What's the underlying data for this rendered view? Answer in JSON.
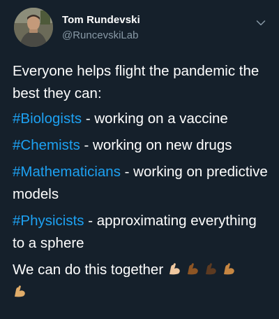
{
  "tweet": {
    "author_name": "Tom Rundevski",
    "author_handle": "@RuncevskiLab",
    "intro": "Everyone helps flight the pandemic the best they can:",
    "lines": [
      {
        "hashtag": "#Biologists",
        "text": " - working on a vaccine"
      },
      {
        "hashtag": "#Chemists",
        "text": " - working on new drugs"
      },
      {
        "hashtag": "#Mathematicians",
        "text": " - working on predictive models"
      },
      {
        "hashtag": "#Physicists",
        "text": " - approximating everything to a sphere"
      }
    ],
    "closing": "We can do this together",
    "emojis": [
      "flexed-biceps-light",
      "flexed-biceps-medium-dark",
      "flexed-biceps-dark",
      "flexed-biceps-medium",
      "flexed-biceps-medium-light"
    ]
  },
  "colors": {
    "background": "#15202b",
    "text": "#ffffff",
    "handle": "#8899a6",
    "hashtag": "#1da1f2",
    "skin_tones": [
      "#f0c8a0",
      "#8d5524",
      "#5c3a21",
      "#c68642",
      "#e0ac69"
    ]
  }
}
